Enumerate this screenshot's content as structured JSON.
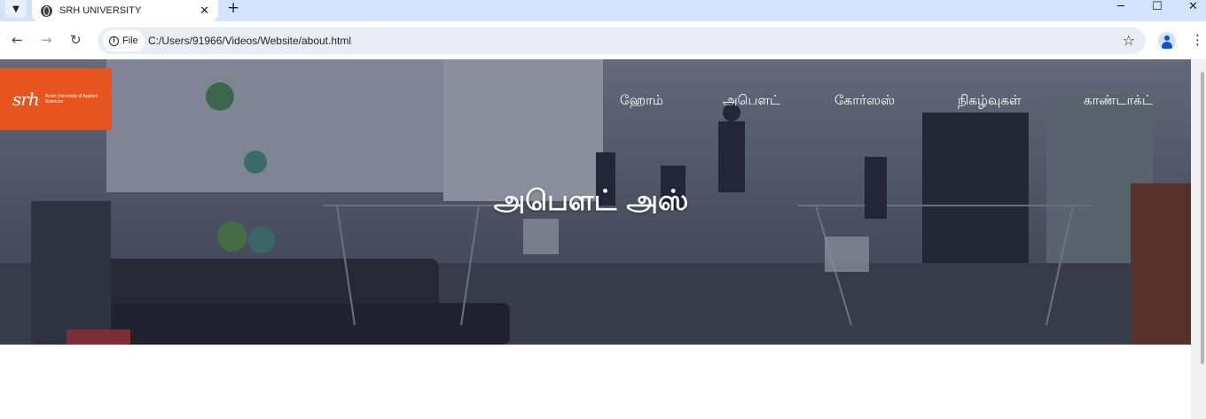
{
  "browser": {
    "tab_title": "SRH UNIVERSITY",
    "tab_close": "✕",
    "new_tab": "+",
    "tab_search_icon": "chevron-down",
    "security_chip": "File",
    "url": "C:/Users/91966/Videos/Website/about.html",
    "window_controls": {
      "minimize": "─",
      "maximize": "☐",
      "close": "✕"
    },
    "nav": {
      "back": "←",
      "forward": "→",
      "reload": "↻"
    },
    "bookmark_icon": "☆",
    "menu_icon": "⋮"
  },
  "site": {
    "logo": {
      "mark": "srh",
      "subtitle": "Berlin University of Applied Sciences",
      "color": "#e8541d"
    },
    "nav": [
      {
        "label": "ஹோம்"
      },
      {
        "label": "அபௌட்"
      },
      {
        "label": "கோர்ஸஸ்"
      },
      {
        "label": "நிகழ்வுகள்"
      },
      {
        "label": "காண்டாக்ட்"
      }
    ],
    "hero": {
      "title": "அபௌட் அஸ்"
    }
  }
}
